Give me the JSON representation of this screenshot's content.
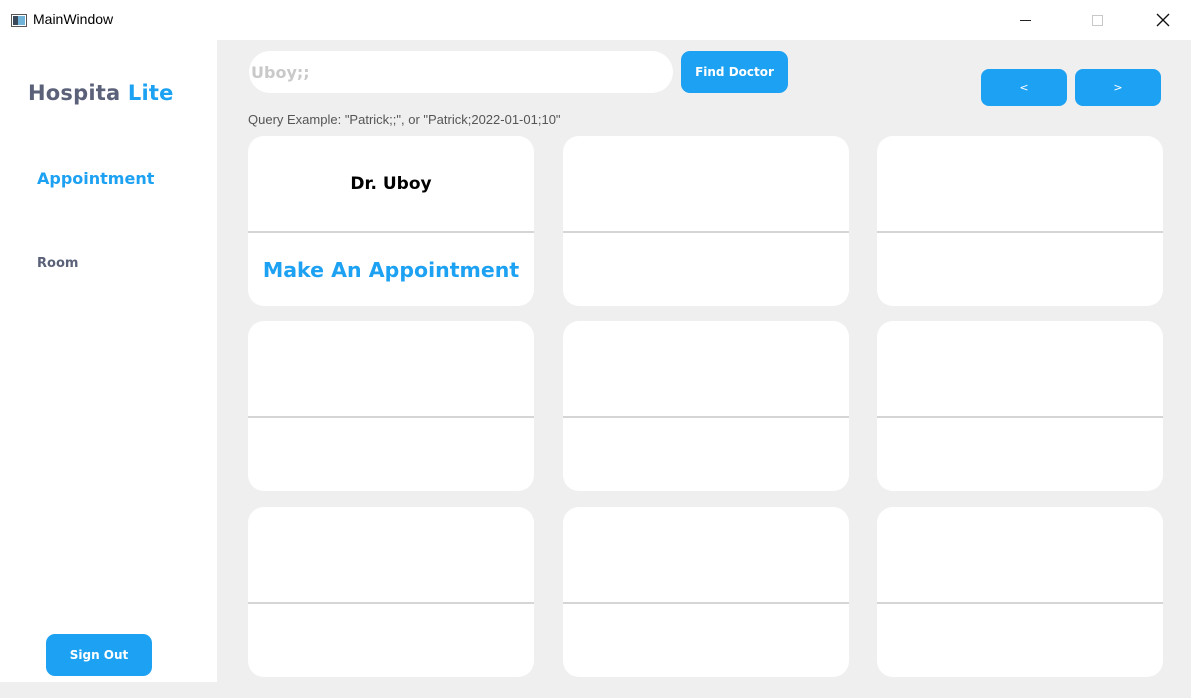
{
  "window": {
    "title": "MainWindow"
  },
  "sidebar": {
    "brand_primary": "Hospita",
    "brand_accent": "Lite",
    "nav": [
      {
        "label": "Appointment",
        "active": true
      },
      {
        "label": "Room",
        "active": false
      }
    ],
    "signout_label": "Sign Out"
  },
  "search": {
    "value": "Uboy;;",
    "find_label": "Find Doctor",
    "hint": "Query Example: \"Patrick;;\", or \"Patrick;2022-01-01;10\""
  },
  "pagination": {
    "prev_label": "<",
    "next_label": ">"
  },
  "cards": [
    {
      "doctor": "Dr. Uboy",
      "action": "Make An Appointment"
    },
    {
      "doctor": "",
      "action": ""
    },
    {
      "doctor": "",
      "action": ""
    },
    {
      "doctor": "",
      "action": ""
    },
    {
      "doctor": "",
      "action": ""
    },
    {
      "doctor": "",
      "action": ""
    },
    {
      "doctor": "",
      "action": ""
    },
    {
      "doctor": "",
      "action": ""
    },
    {
      "doctor": "",
      "action": ""
    }
  ],
  "colors": {
    "accent": "#1da1f2",
    "brand_text": "#5a6178",
    "content_bg": "#efefef",
    "card_bg": "#ffffff"
  },
  "icons": {
    "app": "window-app-icon",
    "minimize": "minimize-icon",
    "maximize": "maximize-icon",
    "close": "close-icon"
  }
}
